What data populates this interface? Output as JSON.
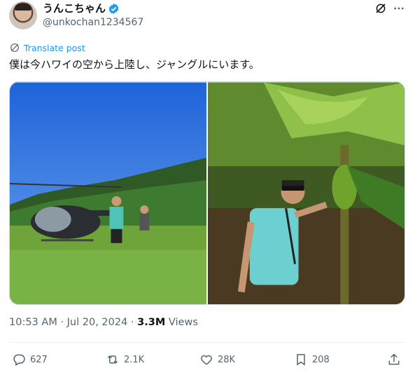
{
  "user": {
    "display_name": "うんこちゃん",
    "handle": "@unkochan1234567",
    "verified": true
  },
  "header_icons": [
    "grok-icon",
    "more-icon"
  ],
  "translate": {
    "label": "Translate post",
    "icon": "globe-icon"
  },
  "tweet": {
    "text": "僕は今ハワイの空から上陸し、ジャングルにいます。"
  },
  "media": {
    "count": 2
  },
  "meta": {
    "time": "10:53 AM",
    "sep1": " · ",
    "date": "Jul 20, 2024",
    "sep2": " · ",
    "views": "3.3M",
    "views_label": " Views"
  },
  "actions": {
    "replies": "627",
    "reposts": "2.1K",
    "likes": "28K",
    "bookmarks": "208"
  },
  "colors": {
    "accent": "#1d9bf0",
    "secondary_text": "#536471",
    "text": "#0f1419"
  }
}
